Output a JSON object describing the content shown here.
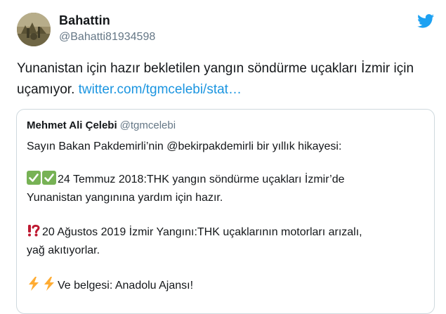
{
  "tweet": {
    "author_name": "Bahattin",
    "author_handle": "@Bahatti81934598",
    "text": "Yunanistan için hazır bekletilen yangın söndürme uçakları İzmir için uçamıyor.",
    "link": "twitter.com/tgmcelebi/stat…"
  },
  "quoted": {
    "author_name": "Mehmet Ali Çelebi",
    "author_handle": "@tgmcelebi",
    "line1": "Sayın Bakan Pakdemirli’nin @bekirpakdemirli bir yıllık hikayesi:",
    "line2": "24 Temmuz 2018:THK yangın söndürme uçakları İzmir’de",
    "line3": "Yunanistan yangınına yardım için hazır.",
    "line4": "20 Ağustos 2019 İzmir Yangını:THK uçaklarının motorları arızalı,",
    "line5": "yağ akıtıyorlar.",
    "line6": "Ve belgesi: Anadolu Ajansı!"
  },
  "icons": {
    "brand": "twitter-bird-icon",
    "check": "check-mark-icon",
    "alert": "exclamation-question-icon",
    "bolt": "lightning-icon"
  },
  "colors": {
    "link": "#1b95e0",
    "secondary_text": "#657786",
    "border": "#cfd9de",
    "check_green": "#77b255",
    "alert_red": "#be1931",
    "bolt_yellow": "#ffac33"
  }
}
